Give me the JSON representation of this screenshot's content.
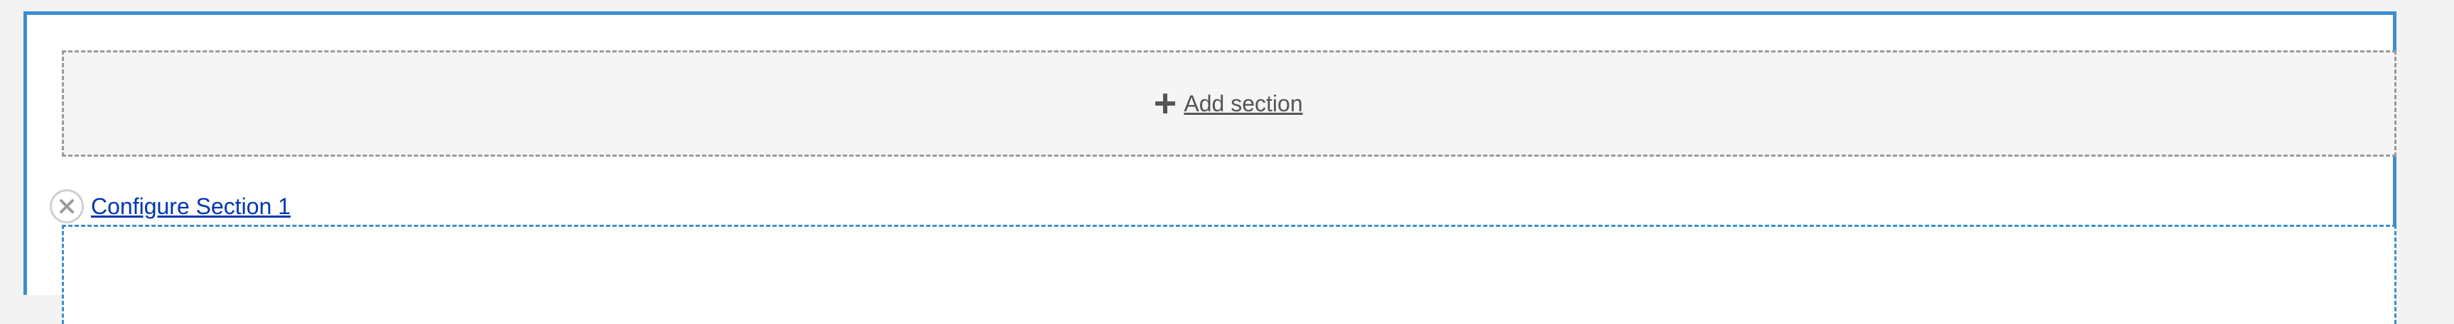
{
  "add_section": {
    "icon": "plus-icon",
    "label": "Add section"
  },
  "section": {
    "remove_icon": "close-icon",
    "configure_label": "Configure Section 1"
  },
  "colors": {
    "accent": "#3a8fd0",
    "link": "#0036b1",
    "muted_text": "#555555",
    "placeholder_bg": "#f5f5f5"
  }
}
